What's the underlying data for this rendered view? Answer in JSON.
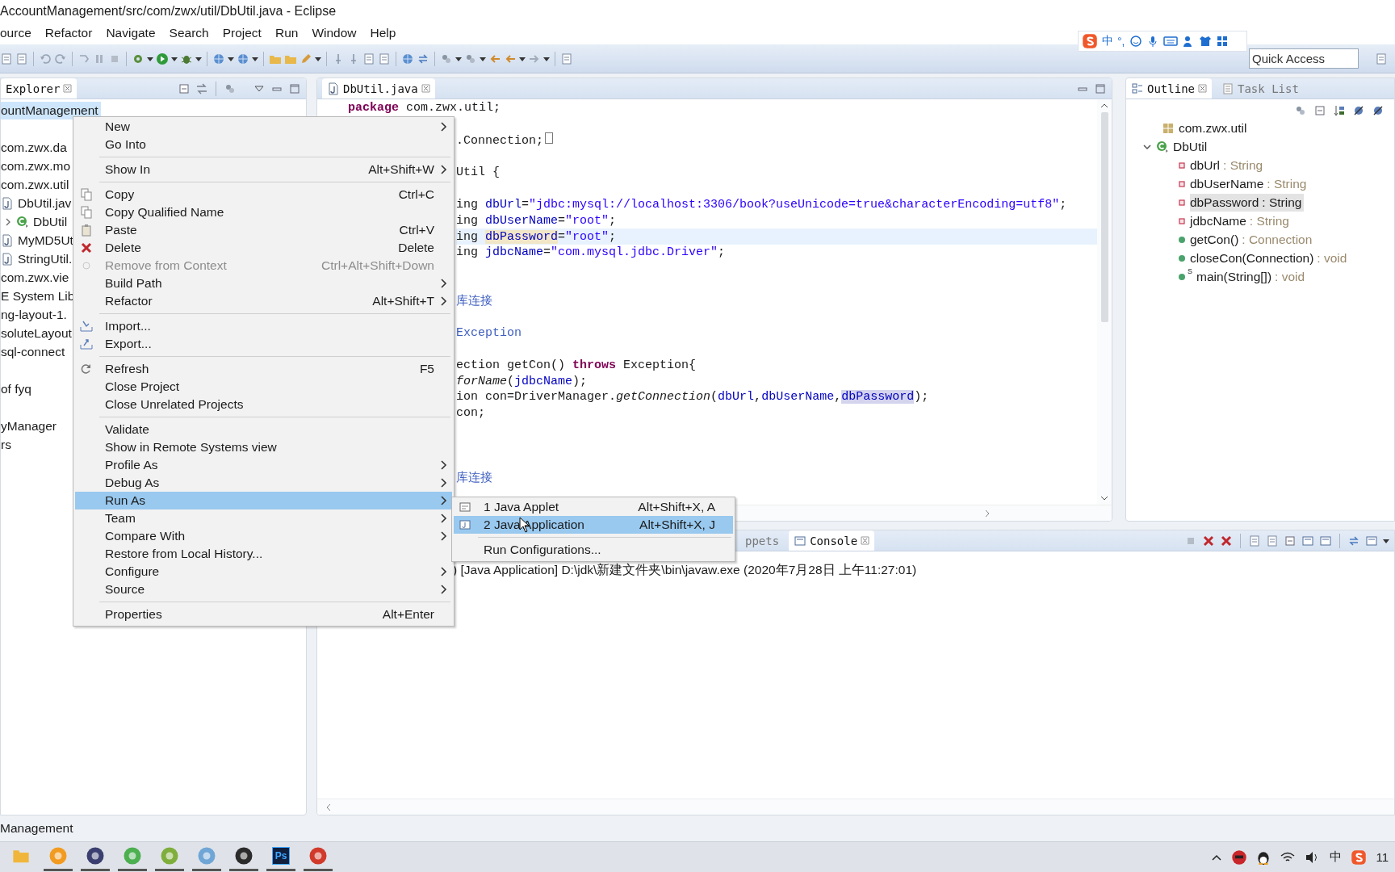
{
  "window": {
    "title": "AccountManagement/src/com/zwx/util/DbUtil.java - Eclipse"
  },
  "menu_bar": [
    "ource",
    "Refactor",
    "Navigate",
    "Search",
    "Project",
    "Run",
    "Window",
    "Help"
  ],
  "ime_bar": {
    "mode": "中",
    "punctuation": "°,"
  },
  "quick_access": {
    "placeholder": "Quick Access"
  },
  "explorer": {
    "tab": {
      "label": "Explorer",
      "selected": true
    },
    "groups": [
      {
        "items": [
          {
            "label": "ountManagement",
            "kind": "plain",
            "selected": true
          }
        ]
      },
      {
        "items": [
          {
            "label": "com.zwx.da",
            "kind": "plain",
            "selected": false
          },
          {
            "label": "com.zwx.mo",
            "kind": "plain",
            "selected": false
          },
          {
            "label": "com.zwx.util",
            "kind": "plain",
            "selected": false
          },
          {
            "label": "DbUtil.jav",
            "kind": "java-file",
            "selected": false,
            "children": [
              {
                "label": "DbUtil",
                "kind": "class",
                "selected": false,
                "expanded": false
              }
            ]
          },
          {
            "label": "MyMD5Ut",
            "kind": "java-file",
            "selected": false
          },
          {
            "label": "StringUtil.",
            "kind": "java-file",
            "selected": false
          },
          {
            "label": "com.zwx.vie",
            "kind": "plain",
            "selected": false
          },
          {
            "label": "E System Lib",
            "kind": "plain",
            "selected": false
          },
          {
            "label": "ng-layout-1.",
            "kind": "plain",
            "selected": false
          },
          {
            "label": "soluteLayout",
            "kind": "plain",
            "selected": false
          },
          {
            "label": "sql-connect",
            "kind": "plain",
            "selected": false
          }
        ]
      },
      {
        "items": [
          {
            "label": "of fyq",
            "kind": "plain",
            "selected": false
          }
        ]
      },
      {
        "items": [
          {
            "label": "yManager",
            "kind": "plain",
            "selected": false
          },
          {
            "label": "rs",
            "kind": "plain",
            "selected": false
          }
        ]
      }
    ]
  },
  "editor": {
    "tab": {
      "label": "DbUtil.java",
      "selected": true
    },
    "lines": [
      {
        "kind": "full",
        "current": false,
        "segments": [
          {
            "text": "package",
            "kind": "keyword"
          },
          {
            "text": " com.zwx.util;",
            "kind": "plain"
          }
        ]
      },
      {
        "kind": "blank",
        "current": false
      },
      {
        "kind": "cut",
        "current": false,
        "segments": [
          {
            "text": ".Connection;",
            "kind": "plain"
          },
          {
            "kind": "fold"
          }
        ]
      },
      {
        "kind": "blank",
        "current": false
      },
      {
        "kind": "cut",
        "current": false,
        "segments": [
          {
            "text": "Util {",
            "kind": "plain"
          }
        ]
      },
      {
        "kind": "blank",
        "current": false
      },
      {
        "kind": "cut",
        "current": false,
        "segments": [
          {
            "text": "ing ",
            "kind": "plain"
          },
          {
            "text": "dbUrl",
            "kind": "field"
          },
          {
            "text": "=",
            "kind": "plain"
          },
          {
            "text": "\"jdbc:mysql://localhost:3306/book?useUnicode=true&characterEncoding=utf8\"",
            "kind": "string"
          },
          {
            "text": ";",
            "kind": "plain"
          }
        ]
      },
      {
        "kind": "cut",
        "current": false,
        "segments": [
          {
            "text": "ing ",
            "kind": "plain"
          },
          {
            "text": "dbUserName",
            "kind": "field"
          },
          {
            "text": "=",
            "kind": "plain"
          },
          {
            "text": "\"root\"",
            "kind": "string"
          },
          {
            "text": ";",
            "kind": "plain"
          }
        ]
      },
      {
        "kind": "cut",
        "current": true,
        "segments": [
          {
            "text": "ing ",
            "kind": "plain"
          },
          {
            "text": "dbPassword",
            "kind": "declaration"
          },
          {
            "text": "=",
            "kind": "plain"
          },
          {
            "text": "\"root\"",
            "kind": "string"
          },
          {
            "text": ";",
            "kind": "plain"
          }
        ]
      },
      {
        "kind": "cut",
        "current": false,
        "segments": [
          {
            "text": "ing ",
            "kind": "plain"
          },
          {
            "text": "jdbcName",
            "kind": "field"
          },
          {
            "text": "=",
            "kind": "plain"
          },
          {
            "text": "\"com.mysql.jdbc.Driver\"",
            "kind": "string"
          },
          {
            "text": ";",
            "kind": "plain"
          }
        ]
      },
      {
        "kind": "blank",
        "current": false
      },
      {
        "kind": "blank",
        "current": false
      },
      {
        "kind": "cut",
        "current": false,
        "segments": [
          {
            "text": "库连接",
            "kind": "comment"
          }
        ]
      },
      {
        "kind": "blank",
        "current": false
      },
      {
        "kind": "cut",
        "current": false,
        "segments": [
          {
            "text": "Exception",
            "kind": "comment"
          }
        ]
      },
      {
        "kind": "blank",
        "current": false
      },
      {
        "kind": "cut",
        "current": false,
        "segments": [
          {
            "text": "ection getCon() ",
            "kind": "plain"
          },
          {
            "text": "throws",
            "kind": "keyword"
          },
          {
            "text": " Exception{",
            "kind": "plain"
          }
        ]
      },
      {
        "kind": "cut",
        "current": false,
        "segments": [
          {
            "text": "forName",
            "kind": "static"
          },
          {
            "text": "(",
            "kind": "plain"
          },
          {
            "text": "jdbcName",
            "kind": "field"
          },
          {
            "text": ");",
            "kind": "plain"
          }
        ]
      },
      {
        "kind": "cut",
        "current": false,
        "segments": [
          {
            "text": "ion con=DriverManager.",
            "kind": "plain"
          },
          {
            "text": "getConnection",
            "kind": "static"
          },
          {
            "text": "(",
            "kind": "plain"
          },
          {
            "text": "dbUrl",
            "kind": "field"
          },
          {
            "text": ",",
            "kind": "plain"
          },
          {
            "text": "dbUserName",
            "kind": "field"
          },
          {
            "text": ",",
            "kind": "plain"
          },
          {
            "text": "dbPassword",
            "kind": "occurrence"
          },
          {
            "text": ");",
            "kind": "plain"
          }
        ]
      },
      {
        "kind": "cut",
        "current": false,
        "segments": [
          {
            "text": "con;",
            "kind": "plain"
          }
        ]
      },
      {
        "kind": "blank",
        "current": false
      },
      {
        "kind": "blank",
        "current": false
      },
      {
        "kind": "blank",
        "current": false
      },
      {
        "kind": "cut",
        "current": false,
        "segments": [
          {
            "text": "库连接",
            "kind": "comment"
          }
        ]
      }
    ]
  },
  "outline": {
    "tabs": [
      {
        "label": "Outline",
        "selected": true
      },
      {
        "label": "Task List",
        "selected": false
      }
    ],
    "tree": [
      {
        "label": "com.zwx.util",
        "kind": "package"
      },
      {
        "label": "DbUtil",
        "kind": "class",
        "expanded": true,
        "children": [
          {
            "name": "dbUrl",
            "type": ": String",
            "kind": "field",
            "selected": false
          },
          {
            "name": "dbUserName",
            "type": ": String",
            "kind": "field",
            "selected": false
          },
          {
            "name": "dbPassword",
            "type": ": String",
            "kind": "field",
            "selected": true
          },
          {
            "name": "jdbcName",
            "type": ": String",
            "kind": "field",
            "selected": false
          },
          {
            "name": "getCon()",
            "type": ": Connection",
            "kind": "method",
            "selected": false
          },
          {
            "name": "closeCon(Connection)",
            "type": ": void",
            "kind": "method",
            "selected": false
          },
          {
            "name": "main(String[])",
            "type": ": void",
            "kind": "method",
            "selected": false,
            "modifier": "S"
          }
        ]
      }
    ]
  },
  "console": {
    "tabs": [
      {
        "label": "ppets",
        "selected": false
      },
      {
        "label": "Console",
        "selected": true
      }
    ],
    "lines": [
      ") [Java Application] D:\\jdk\\新建文件夹\\bin\\javaw.exe (2020年7月28日 上午11:27:01)"
    ]
  },
  "context_menu": {
    "items": [
      {
        "kind": "item",
        "label": "New",
        "submenu": true,
        "disabled": false,
        "selected": false
      },
      {
        "kind": "item",
        "label": "Go Into",
        "submenu": false,
        "disabled": false,
        "selected": false
      },
      {
        "kind": "separator"
      },
      {
        "kind": "item",
        "label": "Show In",
        "shortcut": "Alt+Shift+W",
        "submenu": true,
        "disabled": false,
        "selected": false
      },
      {
        "kind": "separator"
      },
      {
        "kind": "item",
        "label": "Copy",
        "shortcut": "Ctrl+C",
        "submenu": false,
        "disabled": false,
        "selected": false
      },
      {
        "kind": "item",
        "label": "Copy Qualified Name",
        "submenu": false,
        "disabled": false,
        "selected": false
      },
      {
        "kind": "item",
        "label": "Paste",
        "shortcut": "Ctrl+V",
        "submenu": false,
        "disabled": false,
        "selected": false
      },
      {
        "kind": "item",
        "label": "Delete",
        "shortcut": "Delete",
        "submenu": false,
        "disabled": false,
        "selected": false
      },
      {
        "kind": "item",
        "label": "Remove from Context",
        "shortcut": "Ctrl+Alt+Shift+Down",
        "submenu": false,
        "disabled": true,
        "selected": false
      },
      {
        "kind": "item",
        "label": "Build Path",
        "submenu": true,
        "disabled": false,
        "selected": false
      },
      {
        "kind": "item",
        "label": "Refactor",
        "shortcut": "Alt+Shift+T",
        "submenu": true,
        "disabled": false,
        "selected": false
      },
      {
        "kind": "separator"
      },
      {
        "kind": "item",
        "label": "Import...",
        "submenu": false,
        "disabled": false,
        "selected": false
      },
      {
        "kind": "item",
        "label": "Export...",
        "submenu": false,
        "disabled": false,
        "selected": false
      },
      {
        "kind": "separator"
      },
      {
        "kind": "item",
        "label": "Refresh",
        "shortcut": "F5",
        "submenu": false,
        "disabled": false,
        "selected": false
      },
      {
        "kind": "item",
        "label": "Close Project",
        "submenu": false,
        "disabled": false,
        "selected": false
      },
      {
        "kind": "item",
        "label": "Close Unrelated Projects",
        "submenu": false,
        "disabled": false,
        "selected": false
      },
      {
        "kind": "separator"
      },
      {
        "kind": "item",
        "label": "Validate",
        "submenu": false,
        "disabled": false,
        "selected": false
      },
      {
        "kind": "item",
        "label": "Show in Remote Systems view",
        "submenu": false,
        "disabled": false,
        "selected": false
      },
      {
        "kind": "item",
        "label": "Profile As",
        "submenu": true,
        "disabled": false,
        "selected": false
      },
      {
        "kind": "item",
        "label": "Debug As",
        "submenu": true,
        "disabled": false,
        "selected": false
      },
      {
        "kind": "item",
        "label": "Run As",
        "submenu": true,
        "disabled": false,
        "selected": true
      },
      {
        "kind": "item",
        "label": "Team",
        "submenu": true,
        "disabled": false,
        "selected": false
      },
      {
        "kind": "item",
        "label": "Compare With",
        "submenu": true,
        "disabled": false,
        "selected": false
      },
      {
        "kind": "item",
        "label": "Restore from Local History...",
        "submenu": false,
        "disabled": false,
        "selected": false
      },
      {
        "kind": "item",
        "label": "Configure",
        "submenu": true,
        "disabled": false,
        "selected": false
      },
      {
        "kind": "item",
        "label": "Source",
        "submenu": true,
        "disabled": false,
        "selected": false
      },
      {
        "kind": "separator"
      },
      {
        "kind": "item",
        "label": "Properties",
        "shortcut": "Alt+Enter",
        "submenu": false,
        "disabled": false,
        "selected": false
      }
    ]
  },
  "run_as_menu": {
    "items": [
      {
        "kind": "item",
        "label": "1 Java Applet",
        "shortcut": "Alt+Shift+X, A",
        "selected": false
      },
      {
        "kind": "item",
        "label": "2 Java Application",
        "shortcut": "Alt+Shift+X, J",
        "selected": true
      },
      {
        "kind": "separator"
      },
      {
        "kind": "item",
        "label": "Run Configurations...",
        "selected": false
      }
    ]
  },
  "status_bar": {
    "text": "Management"
  },
  "taskbar": {
    "apps": [
      {
        "kind": "folder"
      },
      {
        "kind": "orange"
      },
      {
        "kind": "eclipse"
      },
      {
        "kind": "green"
      },
      {
        "kind": "notepad"
      },
      {
        "kind": "blue"
      },
      {
        "kind": "dark"
      },
      {
        "kind": "photoshop",
        "label": "Ps"
      },
      {
        "kind": "red"
      }
    ],
    "tray_ime": "中",
    "clock": "11"
  }
}
